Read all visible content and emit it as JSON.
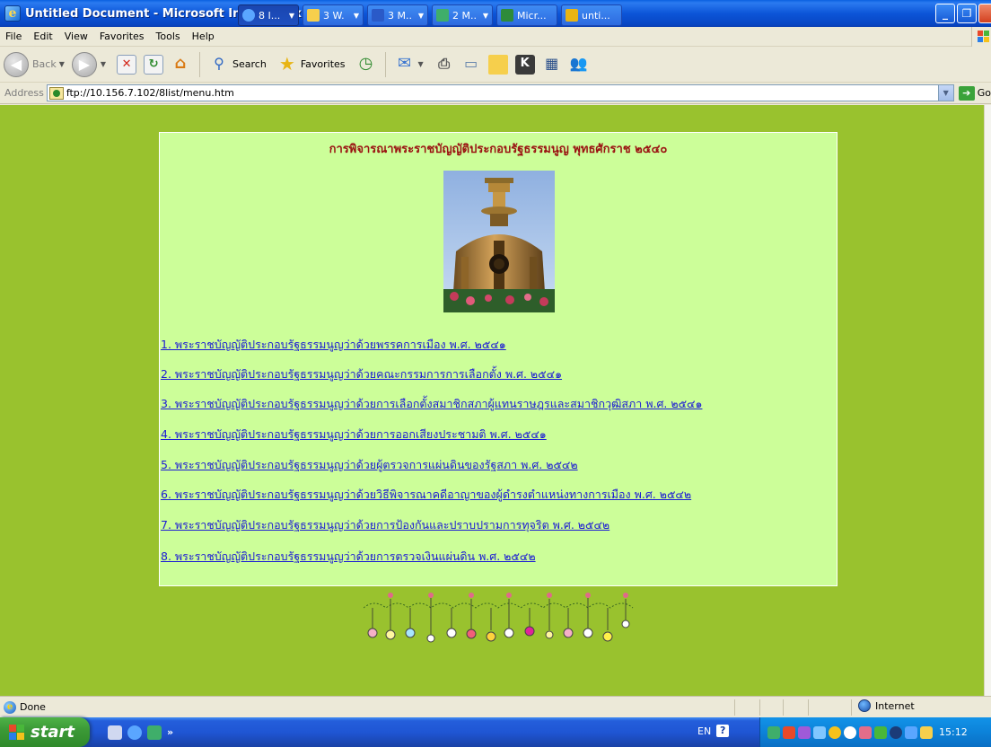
{
  "window": {
    "title": "Untitled Document - Microsoft Internet Explorer"
  },
  "menu": [
    "File",
    "Edit",
    "View",
    "Favorites",
    "Tools",
    "Help"
  ],
  "toolbar": {
    "back_label": "Back",
    "search_label": "Search",
    "favorites_label": "Favorites"
  },
  "address": {
    "label": "Address",
    "url": "ftp://10.156.7.102/8list/menu.htm",
    "go_label": "Go"
  },
  "page": {
    "background": "#99c22e",
    "panel_background": "#ccfe99",
    "title_color": "#9a1111",
    "link_color": "#1b1bd4",
    "title": "การพิจารณาพระราชบัญญัติประกอบรัฐธรรมนูญ พุทธศักราช ๒๕๔๐",
    "links": [
      "1. พระราชบัญญัติประกอบรัฐธรรมนูญว่าด้วยพรรคการเมือง พ.ศ. ๒๕๔๑",
      "2. พระราชบัญญัติประกอบรัฐธรรมนูญว่าด้วยคณะกรรมการการเลือกตั้ง พ.ศ. ๒๕๔๑",
      "3. พระราชบัญญัติประกอบรัฐธรรมนูญว่าด้วยการเลือกตั้งสมาชิกสภาผู้แทนราษฎรและสมาชิกวุฒิสภา พ.ศ. ๒๕๔๑",
      "4. พระราชบัญญัติประกอบรัฐธรรมนูญว่าด้วยการออกเสียงประชามติ พ.ศ. ๒๕๔๑",
      "5. พระราชบัญญัติประกอบรัฐธรรมนูญว่าด้วยผู้ตรวจการแผ่นดินของรัฐสภา พ.ศ. ๒๕๔๒",
      "6. พระราชบัญญัติประกอบรัฐธรรมนูญว่าด้วยวิธีพิจารณาคดีอาญาของผู้ดำรงตำแหน่งทางการเมือง พ.ศ. ๒๕๔๒",
      "7. พระราชบัญญัติประกอบรัฐธรรมนูญว่าด้วยการป้องกันและปราบปรามการทุจริต พ.ศ. ๒๕๔๒",
      "8. พระราชบัญญัติประกอบรัฐธรรมนูญว่าด้วยการตรวจเงินแผ่นดิน พ.ศ. ๒๕๔๒"
    ]
  },
  "status": {
    "text": "Done",
    "zone": "Internet"
  },
  "taskbar": {
    "start_label": "start",
    "tasks": [
      "8 I...",
      "3 W.",
      "3 M..",
      "2 M..",
      "Micr...",
      "unti..."
    ],
    "lang": "EN",
    "clock": "15:12"
  }
}
